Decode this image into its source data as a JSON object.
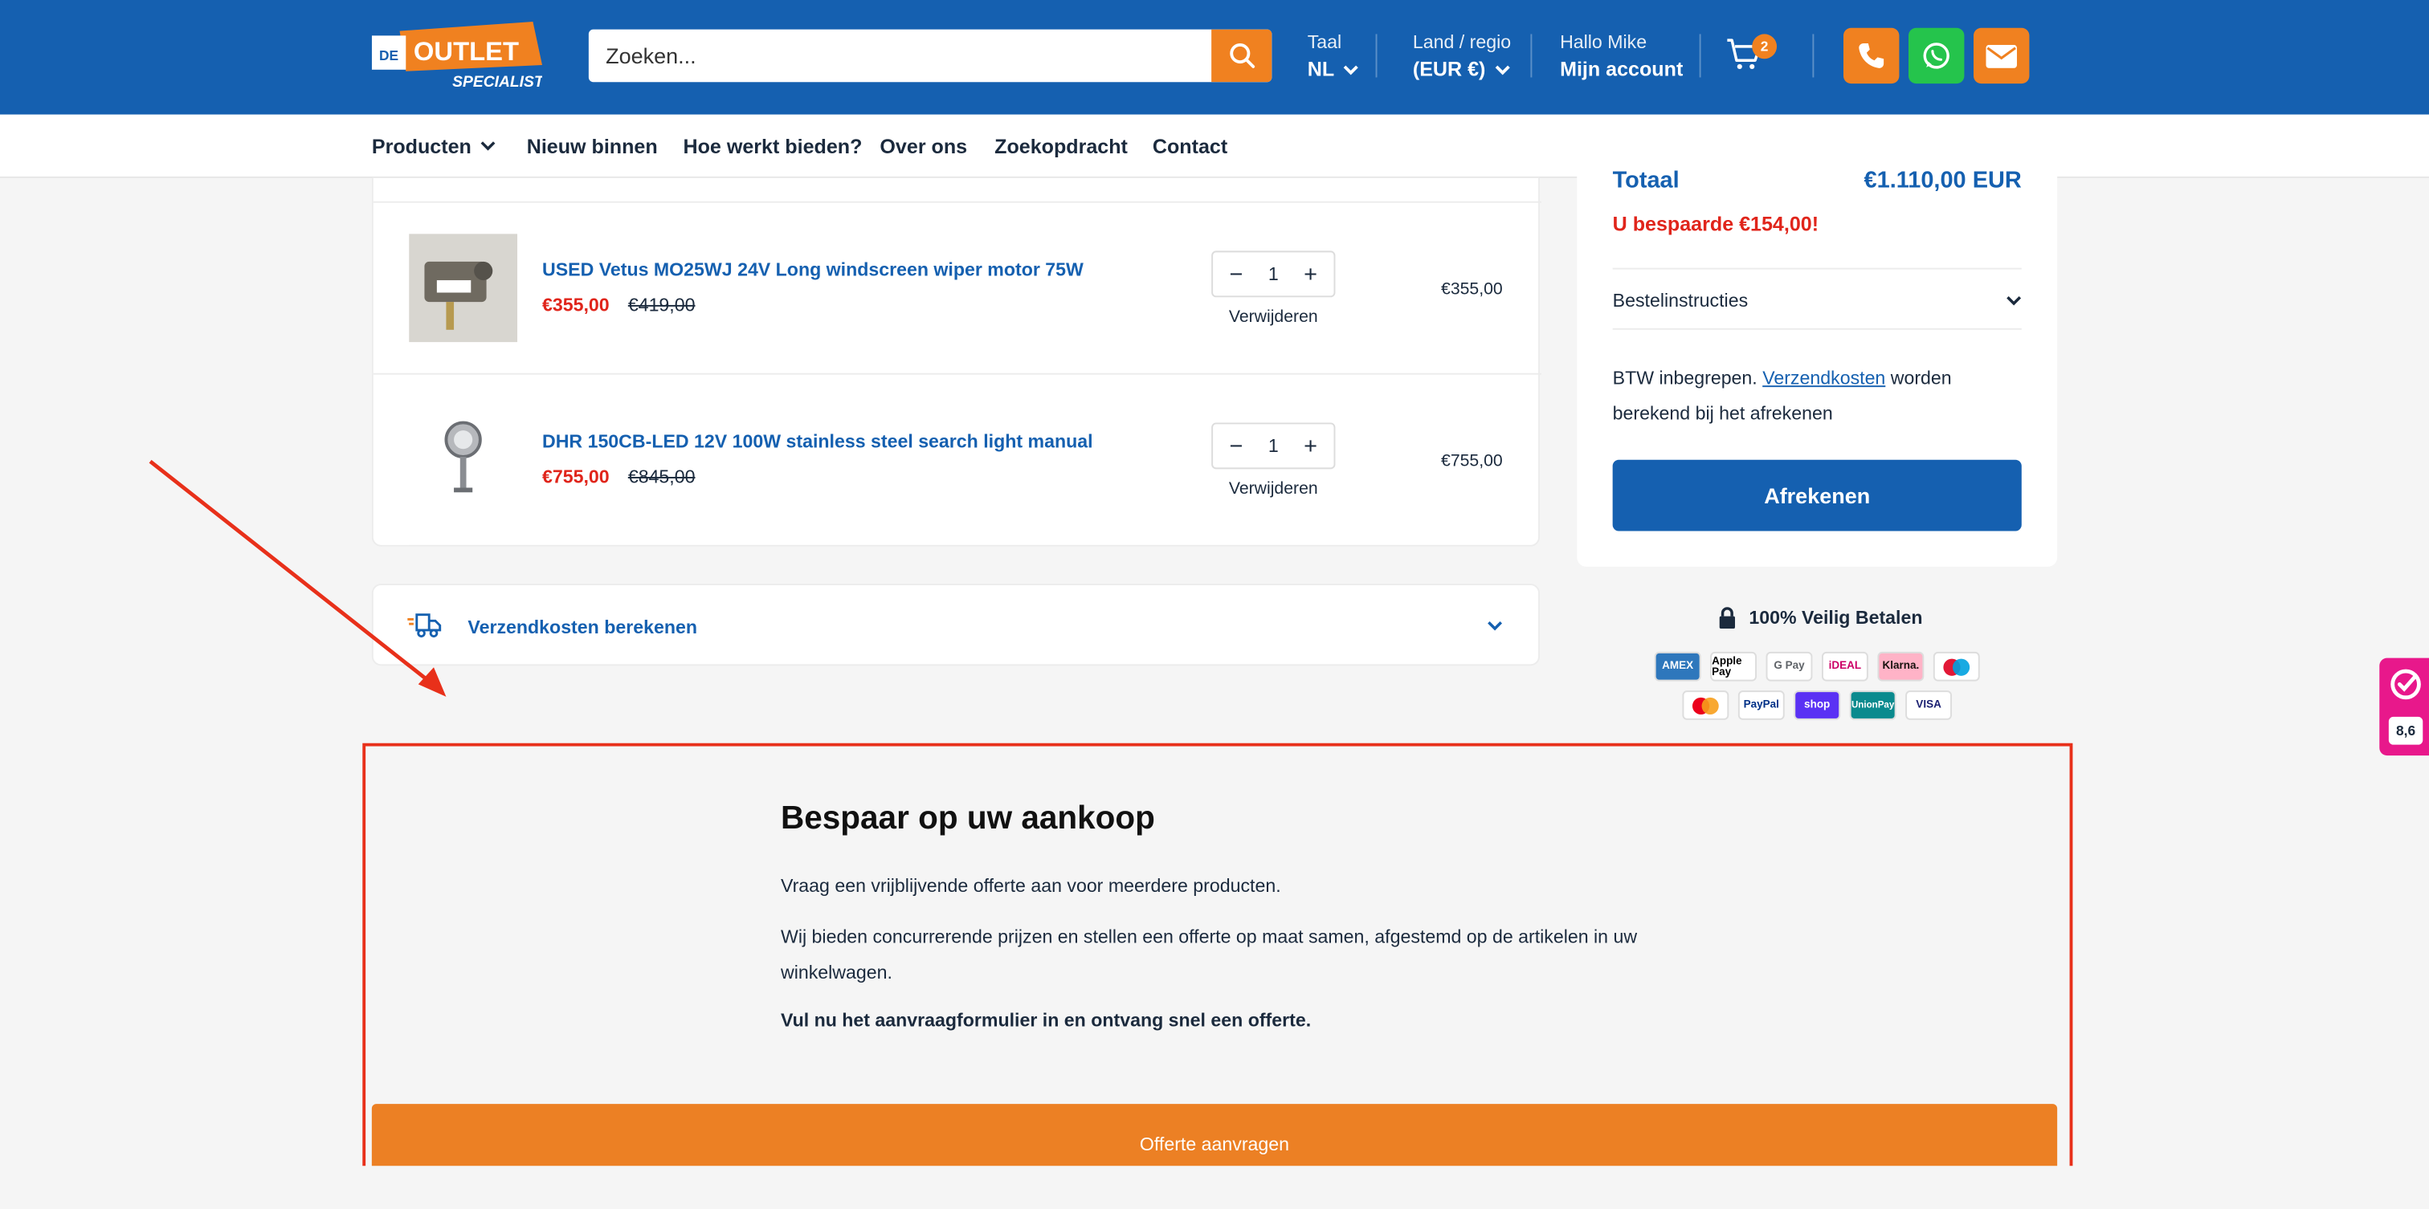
{
  "header": {
    "logo": {
      "de": "DE",
      "outlet": "OUTLET",
      "specialist": "SPECIALIST"
    },
    "search_placeholder": "Zoeken...",
    "language": {
      "label": "Taal",
      "value": "NL"
    },
    "region": {
      "label": "Land / regio",
      "value": "(EUR €)"
    },
    "account": {
      "greeting": "Hallo Mike",
      "link": "Mijn account"
    },
    "cart_count": "2",
    "colors": {
      "brand": "#1560b0",
      "accent": "#f08120",
      "whatsapp": "#25c44c"
    }
  },
  "nav": {
    "items": [
      "Producten",
      "Nieuw binnen",
      "Hoe werkt bieden?",
      "Over ons",
      "Zoekopdracht",
      "Contact"
    ]
  },
  "cart": {
    "items": [
      {
        "title": "USED Vetus MO25WJ 24V Long windscreen wiper motor 75W",
        "sale_price": "€355,00",
        "original_price": "€419,00",
        "qty": "1",
        "remove": "Verwijderen",
        "line_total": "€355,00"
      },
      {
        "title": "DHR 150CB-LED 12V 100W stainless steel search light manual",
        "sale_price": "€755,00",
        "original_price": "€845,00",
        "qty": "1",
        "remove": "Verwijderen",
        "line_total": "€755,00"
      }
    ],
    "shipping_calc": "Verzendkosten berekenen"
  },
  "summary": {
    "total_label": "Totaal",
    "total_value": "€1.110,00 EUR",
    "saved": "U bespaarde €154,00!",
    "instructions": "Bestelinstructies",
    "tax_pre": "BTW inbegrepen.",
    "tax_link": "Verzendkosten",
    "tax_post": "worden berekend bij het afrekenen",
    "checkout": "Afrekenen",
    "secure": "100% Veilig Betalen",
    "payment_methods": [
      "AMEX",
      "Apple Pay",
      "G Pay",
      "iDEAL",
      "Klarna.",
      "Maestro",
      "Mastercard",
      "PayPal",
      "shop",
      "UnionPay",
      "VISA"
    ]
  },
  "rating": {
    "score": "8,6"
  },
  "quote": {
    "title": "Bespaar op uw aankoop",
    "p1": "Vraag een vrijblijvende offerte aan voor meerdere producten.",
    "p2": "Wij bieden concurrerende prijzen en stellen een offerte op maat samen, afgestemd op de artikelen in uw winkelwagen.",
    "p3": "Vul nu het aanvraagformulier in en ontvang snel een offerte.",
    "button": "Offerte aanvragen"
  }
}
